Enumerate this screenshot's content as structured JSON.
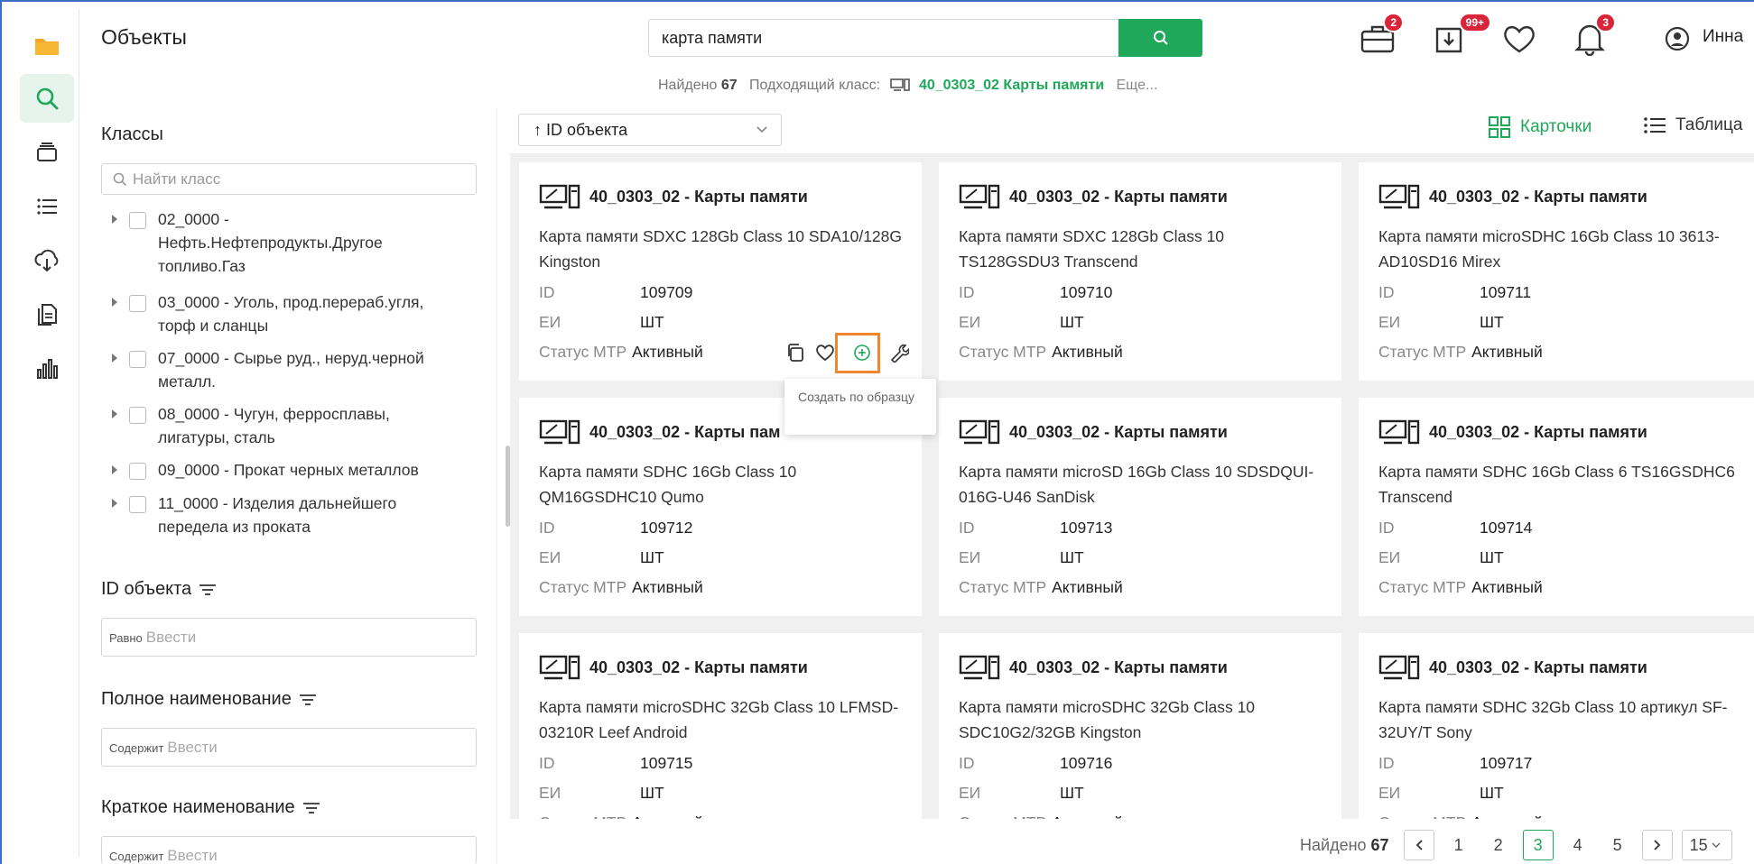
{
  "header": {
    "title": "Объекты",
    "search_value": "карта памяти",
    "found_label": "Найдено",
    "found_count": "67",
    "suitable_class_label": "Подходящий класс:",
    "suitable_class": "40_0303_02 Карты памяти",
    "more_link": "Еще...",
    "badges": {
      "briefcase": "2",
      "downloads": "99+",
      "notifications": "3"
    },
    "user": "Инна"
  },
  "rail": {
    "items": [
      "folder-icon",
      "search-icon",
      "layers-icon",
      "list-icon",
      "cloud-download-icon",
      "documents-icon",
      "chart-icon"
    ],
    "active": "search-icon"
  },
  "filters": {
    "classes_title": "Классы",
    "class_search_placeholder": "Найти класс",
    "tree": [
      {
        "code": "02_0000",
        "name": " -\nНефть.Нефтепродукты.Другое топливо.Газ"
      },
      {
        "code": "03_0000",
        "name": " - Уголь, прод.перераб.угля, торф и сланцы"
      },
      {
        "code": "07_0000",
        "name": " - Сырье руд., неруд.черной металл."
      },
      {
        "code": "08_0000",
        "name": " - Чугун, ферросплавы, лигатуры, сталь"
      },
      {
        "code": "09_0000",
        "name": " - Прокат черных металлов"
      },
      {
        "code": "11_0000",
        "name": " - Изделия дальнейшего передела из проката"
      }
    ],
    "fields": [
      {
        "title": "ID объекта",
        "op": "Равно",
        "placeholder": "Ввести"
      },
      {
        "title": "Полное наименование",
        "op": "Содержит",
        "placeholder": "Ввести"
      },
      {
        "title": "Краткое наименование",
        "op": "Содержит",
        "placeholder": "Ввести"
      }
    ]
  },
  "toolbar": {
    "sort_label": "↑ ID объекта",
    "view_cards": "Карточки",
    "view_table": "Таблица"
  },
  "card_labels": {
    "id": "ID",
    "unit": "ЕИ",
    "status": "Статус МТР"
  },
  "cards": [
    {
      "class": "40_0303_02 - Карты памяти",
      "name": "Карта памяти SDXC 128Gb Class 10 SDA10/128G Kingston",
      "id": "109709",
      "unit": "ШТ",
      "status": "Активный"
    },
    {
      "class": "40_0303_02 - Карты памяти",
      "name": "Карта памяти SDXC 128Gb Class 10 TS128GSDU3 Transcend",
      "id": "109710",
      "unit": "ШТ",
      "status": "Активный"
    },
    {
      "class": "40_0303_02 - Карты памяти",
      "name": "Карта памяти microSDHC 16Gb Class 10 3613-AD10SD16 Mirex",
      "id": "109711",
      "unit": "ШТ",
      "status": "Активный"
    },
    {
      "class": "40_0303_02 - Карты пам",
      "name": "Карта памяти SDHC 16Gb Class 10 QM16GSDHC10 Qumo",
      "id": "109712",
      "unit": "ШТ",
      "status": "Активный"
    },
    {
      "class": "40_0303_02 - Карты памяти",
      "name": "Карта памяти microSD 16Gb Class 10 SDSDQUI-016G-U46 SanDisk",
      "id": "109713",
      "unit": "ШТ",
      "status": "Активный"
    },
    {
      "class": "40_0303_02 - Карты памяти",
      "name": "Карта памяти SDHC 16Gb Class 6 TS16GSDHC6 Transcend",
      "id": "109714",
      "unit": "ШТ",
      "status": "Активный"
    },
    {
      "class": "40_0303_02 - Карты памяти",
      "name": "Карта памяти microSDHC 32Gb Class 10 LFMSD-03210R Leef Android",
      "id": "109715",
      "unit": "ШТ",
      "status": "Активный"
    },
    {
      "class": "40_0303_02 - Карты памяти",
      "name": "Карта памяти microSDHC 32Gb Class 10 SDC10G2/32GB Kingston",
      "id": "109716",
      "unit": "ШТ",
      "status": "Активный"
    },
    {
      "class": "40_0303_02 - Карты памяти",
      "name": "Карта памяти SDHC 32Gb Class 10 артикул SF-32UY/T Sony",
      "id": "109717",
      "unit": "ШТ",
      "status": "Активный"
    }
  ],
  "card_actions": [
    "copy-icon",
    "heart-icon",
    "plus-circle-icon",
    "wrench-icon"
  ],
  "tooltip": "Создать по образцу",
  "pagination": {
    "found_label": "Найдено",
    "found_count": "67",
    "pages": [
      "1",
      "2",
      "3",
      "4",
      "5"
    ],
    "current": "3",
    "page_size": "15"
  },
  "colors": {
    "accent": "#1fa85a",
    "badge": "#d9253a",
    "highlight": "#f0862e",
    "folder": "#f5a623"
  }
}
